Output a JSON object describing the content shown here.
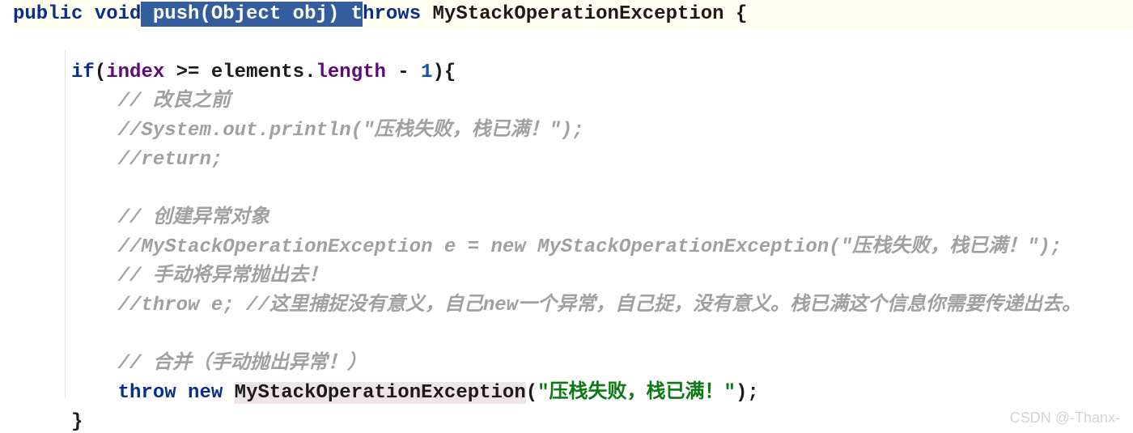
{
  "code": {
    "line1_top": " */",
    "line2": {
      "kw_public": "public",
      "kw_void": "void",
      "sel_text": " push(Object obj) t",
      "kw_throws_rest": "hrows",
      "exc": "MyStackOperationException",
      "brace": " {"
    },
    "line3": {
      "kw_if": "if",
      "open": "(",
      "fld_index": "index",
      "op": " >= ",
      "elements": "elements",
      "dot": ".",
      "length": "length",
      "minus": " - ",
      "one": "1",
      "close": "){"
    },
    "c1": "// 改良之前",
    "c2": "//System.out.println(\"压栈失败，栈已满！\");",
    "c3": "//return;",
    "c4": "// 创建异常对象",
    "c5": "//MyStackOperationException e = new MyStackOperationException(\"压栈失败，栈已满！\");",
    "c6": "// 手动将异常抛出去！",
    "c7": "//throw e; //这里捕捉没有意义，自己new一个异常，自己捉，没有意义。栈已满这个信息你需要传递出去。",
    "c8": "// 合并（手动抛出异常！）",
    "throw_line": {
      "kw_throw": "throw",
      "kw_new": "new",
      "exc": "MyStackOperationException",
      "open": "(",
      "str": "\"压栈失败，栈已满！\"",
      "close": ");"
    },
    "close_brace": "}"
  },
  "watermark": "CSDN @-Thanx-"
}
